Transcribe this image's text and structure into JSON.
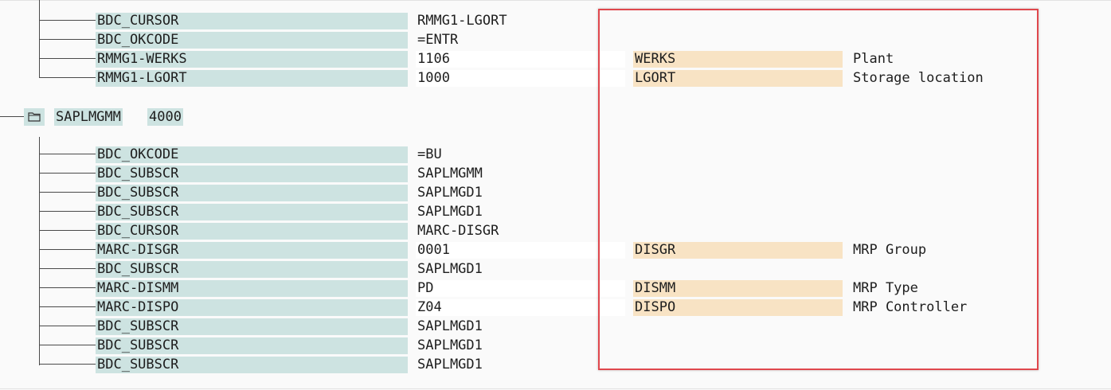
{
  "group1": {
    "rows": [
      {
        "field": "BDC_CURSOR",
        "value": "RMMG1-LGORT",
        "tech": "",
        "desc": ""
      },
      {
        "field": "BDC_OKCODE",
        "value": "=ENTR",
        "tech": "",
        "desc": ""
      },
      {
        "field": "RMMG1-WERKS",
        "value": "1106",
        "tech": "WERKS",
        "desc": "Plant"
      },
      {
        "field": "RMMG1-LGORT",
        "value": "1000",
        "tech": "LGORT",
        "desc": "Storage location"
      }
    ]
  },
  "node": {
    "program": "SAPLMGMM",
    "screen": "4000",
    "icon": "folder-icon"
  },
  "group2": {
    "rows": [
      {
        "field": "BDC_OKCODE",
        "value": "=BU",
        "tech": "",
        "desc": ""
      },
      {
        "field": "BDC_SUBSCR",
        "value": "SAPLMGMM",
        "tech": "",
        "desc": ""
      },
      {
        "field": "BDC_SUBSCR",
        "value": "SAPLMGD1",
        "tech": "",
        "desc": ""
      },
      {
        "field": "BDC_SUBSCR",
        "value": "SAPLMGD1",
        "tech": "",
        "desc": ""
      },
      {
        "field": "BDC_CURSOR",
        "value": "MARC-DISGR",
        "tech": "",
        "desc": ""
      },
      {
        "field": "MARC-DISGR",
        "value": "0001",
        "tech": "DISGR",
        "desc": "MRP Group"
      },
      {
        "field": "BDC_SUBSCR",
        "value": "SAPLMGD1",
        "tech": "",
        "desc": ""
      },
      {
        "field": "MARC-DISMM",
        "value": "PD",
        "tech": "DISMM",
        "desc": "MRP Type"
      },
      {
        "field": "MARC-DISPO",
        "value": "Z04",
        "tech": "DISPO",
        "desc": "MRP Controller"
      },
      {
        "field": "BDC_SUBSCR",
        "value": "SAPLMGD1",
        "tech": "",
        "desc": ""
      },
      {
        "field": "BDC_SUBSCR",
        "value": "SAPLMGD1",
        "tech": "",
        "desc": ""
      },
      {
        "field": "BDC_SUBSCR",
        "value": "SAPLMGD1",
        "tech": "",
        "desc": ""
      }
    ]
  },
  "colors": {
    "field_bg": "#cde3e1",
    "tech_bg": "#f8e3c4",
    "highlight_border": "#e0474d"
  }
}
